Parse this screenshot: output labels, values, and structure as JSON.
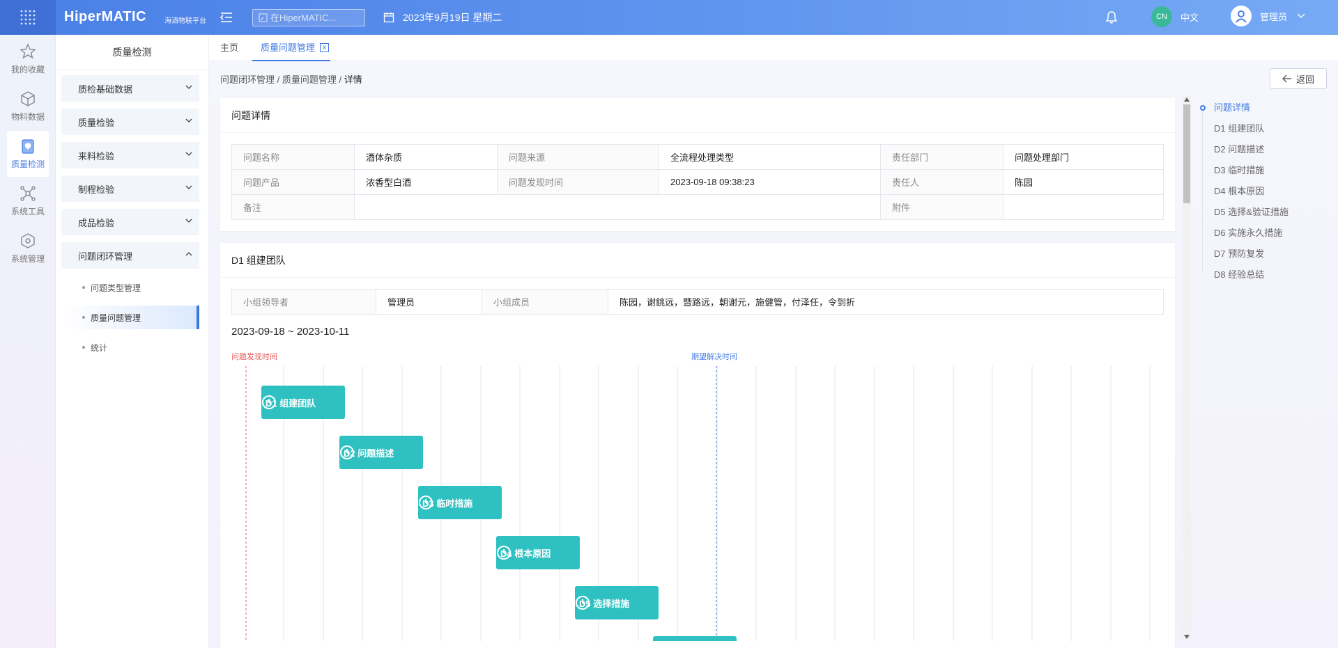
{
  "header": {
    "logo": "HiperMATIC",
    "logo_sub": "海酒物联平台",
    "search_placeholder": "在HiperMATIC...",
    "date": "2023年9月19日 星期二",
    "lang_badge": "CN",
    "lang_label": "中文",
    "user_name": "管理员"
  },
  "rail": [
    {
      "label": "我的收藏",
      "icon": "star-icon"
    },
    {
      "label": "物料数据",
      "icon": "box-icon"
    },
    {
      "label": "质量检测",
      "icon": "shield-doc-icon"
    },
    {
      "label": "系统工具",
      "icon": "nodes-icon"
    },
    {
      "label": "系统管理",
      "icon": "cube-icon"
    }
  ],
  "submenu": {
    "title": "质量检测",
    "groups": [
      "质检基础数据",
      "质量检验",
      "来料检验",
      "制程检验",
      "成品检验",
      "问题闭环管理"
    ],
    "items": [
      "问题类型管理",
      "质量问题管理",
      "统计"
    ]
  },
  "tabs": [
    "主页",
    "质量问题管理"
  ],
  "tab_close": "x",
  "breadcrumb": {
    "a": "问题闭环管理",
    "sep": "/",
    "b": "质量问题管理",
    "c": "详情"
  },
  "back_label": "返回",
  "detail": {
    "title": "问题详情",
    "l_name": "问题名称",
    "v_name": "酒体杂质",
    "l_source": "问题来源",
    "v_source": "全流程处理类型",
    "l_dept": "责任部门",
    "v_dept": "问题处理部门",
    "l_product": "问题产品",
    "v_product": "浓香型白酒",
    "l_time": "问题发现时间",
    "v_time": "2023-09-18 09:38:23",
    "l_owner": "责任人",
    "v_owner": "陈园",
    "l_note": "备注",
    "v_note": "",
    "l_attach": "附件",
    "v_attach": ""
  },
  "d1": {
    "title": "D1 组建团队",
    "l_leader": "小组领导者",
    "v_leader": "管理员",
    "l_members": "小组成员",
    "v_members": "陈园，谢銚远，暨路远，朝谢元，施健管，付泽任，令到折",
    "range": "2023-09-18 ~ 2023-10-11",
    "found_label": "问题发现时间",
    "expect_label": "期望解决时间"
  },
  "tasks": [
    "D1 组建团队",
    "D2 问题描述",
    "D3 临时措施",
    "D4 根本原因",
    "D5 选择措施"
  ],
  "anchors": [
    "问题详情",
    "D1 组建团队",
    "D2 问题描述",
    "D3 临时措施",
    "D4 根本原因",
    "D5 选择&验证措施",
    "D6 实施永久措施",
    "D7 预防复发",
    "D8 经验总结"
  ],
  "colors": {
    "primary": "#3d78e0",
    "task": "#2fc1c1",
    "found_line": "#e85a5a",
    "expect_line": "#4a7fe6"
  }
}
